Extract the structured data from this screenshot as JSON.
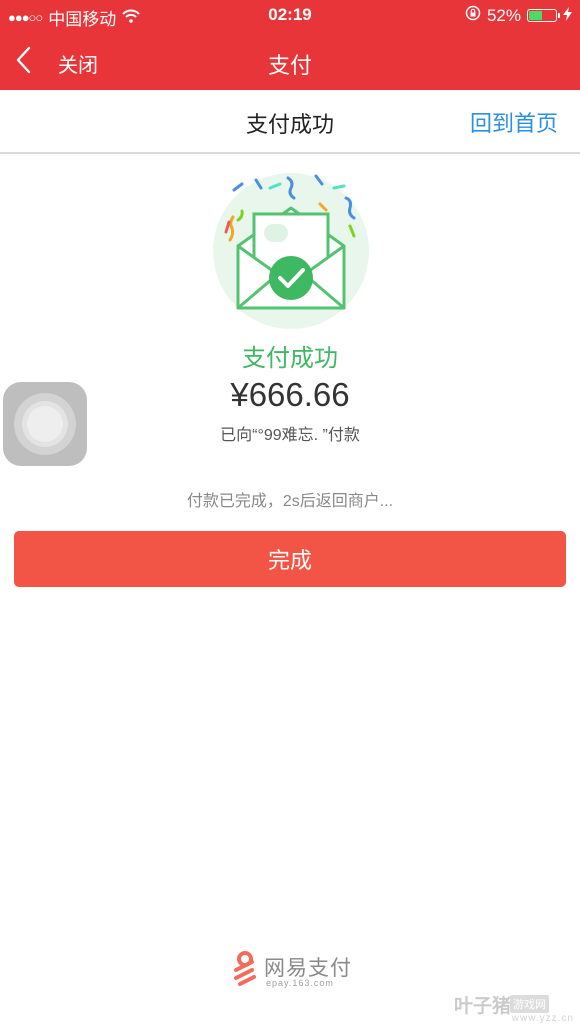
{
  "status_bar": {
    "signal": "●●●○○",
    "carrier": "中国移动",
    "time": "02:19",
    "battery_percent": "52%",
    "battery_level": 0.52
  },
  "nav": {
    "close_label": "关闭",
    "title": "支付"
  },
  "sub_header": {
    "title": "支付成功",
    "home_link": "回到首页"
  },
  "result": {
    "status": "支付成功",
    "amount": "¥666.66",
    "payee": "已向“°99难忘.  ”付款",
    "notice": "付款已完成，2s后返回商户..."
  },
  "done_button": "完成",
  "brand": {
    "name": "网易支付",
    "url": "epay.163.com"
  },
  "watermark": {
    "name": "叶子猪",
    "tag": "游戏网",
    "url": "www.yzz.cn"
  },
  "colors": {
    "header_red": "#e8353a",
    "success_green": "#3fb862",
    "button_red": "#f25545",
    "link_blue": "#2b8fe3"
  }
}
